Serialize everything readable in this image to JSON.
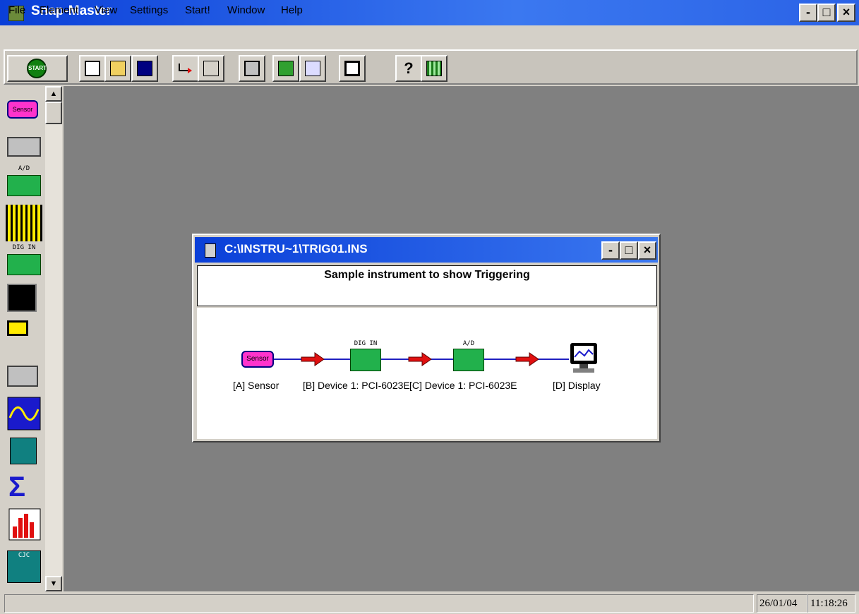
{
  "app": {
    "title": "Snap-Master",
    "window_buttons": {
      "minimize": "-",
      "maximize": "□",
      "close": "×"
    }
  },
  "menu": {
    "items": [
      "File",
      "Element",
      "View",
      "Settings",
      "Start!",
      "Window",
      "Help"
    ]
  },
  "toolbar": {
    "start_label": "START",
    "tools": [
      "new-instrument-icon",
      "open-folder-icon",
      "save-disk-icon",
      "connect-icon",
      "label-icon",
      "element-icon",
      "hardware-config-icon",
      "display-settings-icon",
      "window-icon",
      "help-icon",
      "grid-icon"
    ]
  },
  "palette": {
    "items": [
      {
        "name": "sensor",
        "label": "Sensor"
      },
      {
        "name": "instrument",
        "label": ""
      },
      {
        "name": "a-d",
        "label": "A/D"
      },
      {
        "name": "barcode",
        "label": ""
      },
      {
        "name": "dig-in",
        "label": "DIG IN"
      },
      {
        "name": "disk-reader",
        "label": ""
      },
      {
        "name": "output",
        "label": ""
      },
      {
        "name": "signal-generator",
        "label": ""
      },
      {
        "name": "math",
        "label": ""
      },
      {
        "name": "filter",
        "label": ""
      },
      {
        "name": "sigma",
        "label": ""
      },
      {
        "name": "histogram",
        "label": ""
      },
      {
        "name": "cjc",
        "label": "CJC"
      }
    ]
  },
  "document": {
    "title": "C:\\INSTRU~1\\TRIG01.INS",
    "description": "Sample instrument to show Triggering",
    "window_buttons": {
      "minimize": "-",
      "maximize": "□",
      "close": "×"
    },
    "nodes": [
      {
        "label": "[A] Sensor",
        "icon_text": "Sensor"
      },
      {
        "label": "[B] Device 1: PCI-6023E",
        "icon_text": "DIG IN"
      },
      {
        "label": "[C] Device 1: PCI-6023E",
        "icon_text": "A/D"
      },
      {
        "label": "[D] Display",
        "icon_text": ""
      }
    ]
  },
  "status": {
    "date": "26/01/04",
    "time": "11:18:26"
  },
  "colors": {
    "titlebar": "#0a3fd8",
    "workspace": "#808080",
    "sensor": "#ff33cc",
    "card": "#22b14c",
    "arrow": "#e01010",
    "wire": "#2020c0"
  }
}
